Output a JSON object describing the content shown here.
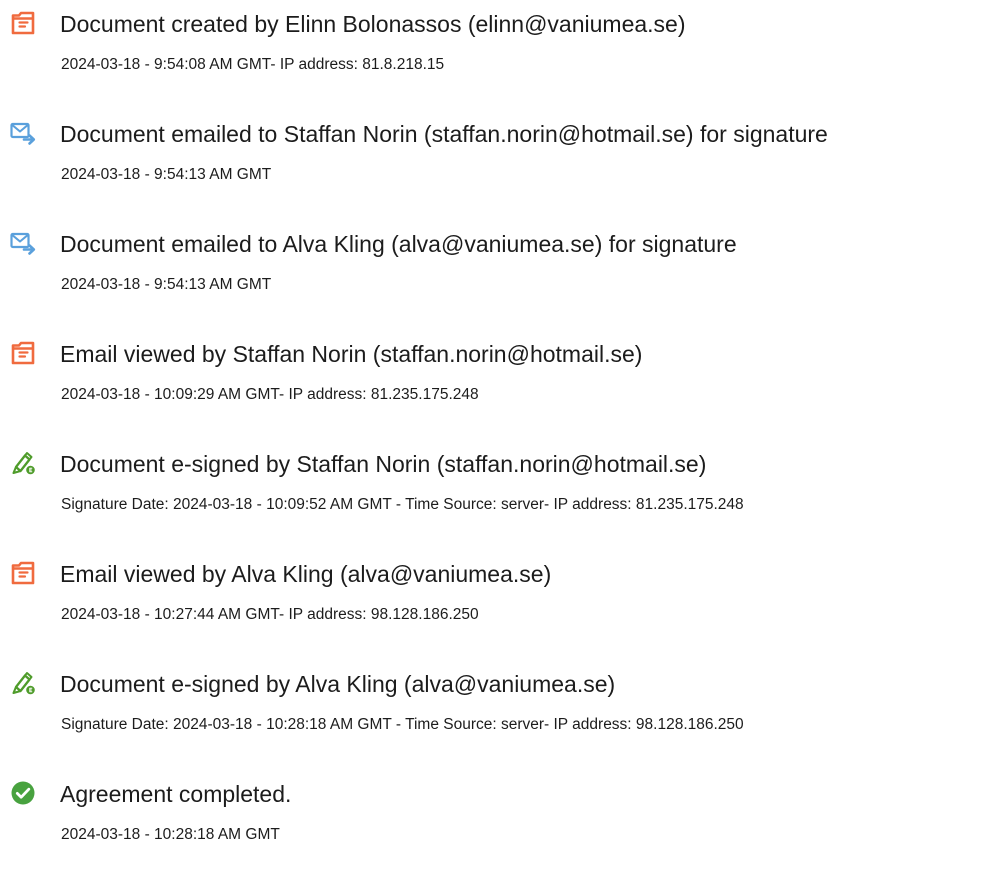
{
  "colors": {
    "document_icon": "#f06b3f",
    "email_icon": "#5aa0dc",
    "sign_icon": "#4f9c2b",
    "complete_icon": "#48a23f",
    "text": "#1c1c1c"
  },
  "events": [
    {
      "icon": "document-icon",
      "title": "Document created by Elinn Bolonassos (elinn@vaniumea.se)",
      "detail": "2024-03-18 - 9:54:08 AM GMT- IP address: 81.8.218.15"
    },
    {
      "icon": "email-sent-icon",
      "title": "Document emailed to Staffan Norin (staffan.norin@hotmail.se) for signature",
      "detail": "2024-03-18 - 9:54:13 AM GMT"
    },
    {
      "icon": "email-sent-icon",
      "title": "Document emailed to Alva Kling (alva@vaniumea.se) for signature",
      "detail": "2024-03-18 - 9:54:13 AM GMT"
    },
    {
      "icon": "document-icon",
      "title": "Email viewed by Staffan Norin (staffan.norin@hotmail.se)",
      "detail": "2024-03-18 - 10:09:29 AM GMT- IP address: 81.235.175.248"
    },
    {
      "icon": "e-sign-pen-icon",
      "title": "Document e-signed by Staffan Norin (staffan.norin@hotmail.se)",
      "detail": "Signature Date: 2024-03-18 - 10:09:52 AM GMT - Time Source: server- IP address: 81.235.175.248"
    },
    {
      "icon": "document-icon",
      "title": "Email viewed by Alva Kling (alva@vaniumea.se)",
      "detail": "2024-03-18 - 10:27:44 AM GMT- IP address: 98.128.186.250"
    },
    {
      "icon": "e-sign-pen-icon",
      "title": "Document e-signed by Alva Kling (alva@vaniumea.se)",
      "detail": "Signature Date: 2024-03-18 - 10:28:18 AM GMT - Time Source: server- IP address: 98.128.186.250"
    },
    {
      "icon": "checkmark-circle-icon",
      "title": "Agreement completed.",
      "detail": "2024-03-18 - 10:28:18 AM GMT"
    }
  ]
}
